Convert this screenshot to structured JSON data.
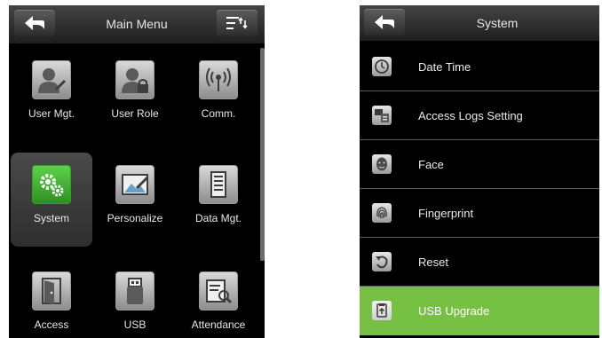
{
  "main_menu": {
    "title": "Main Menu",
    "items": [
      {
        "label": "User Mgt.",
        "icon": "user-edit-icon"
      },
      {
        "label": "User Role",
        "icon": "user-lock-icon"
      },
      {
        "label": "Comm.",
        "icon": "wireless-signal-icon"
      },
      {
        "label": "System",
        "icon": "gears-icon",
        "selected": true
      },
      {
        "label": "Personalize",
        "icon": "picture-pen-icon"
      },
      {
        "label": "Data Mgt.",
        "icon": "computer-tower-icon"
      },
      {
        "label": "Access",
        "icon": "door-icon"
      },
      {
        "label": "USB",
        "icon": "usb-drive-icon"
      },
      {
        "label": "Attendance",
        "icon": "report-search-icon"
      }
    ],
    "selected_color": "#3a9c2a"
  },
  "system_menu": {
    "title": "System",
    "items": [
      {
        "label": "Date Time",
        "icon": "clock-icon"
      },
      {
        "label": "Access Logs Setting",
        "icon": "logs-setting-icon"
      },
      {
        "label": "Face",
        "icon": "face-icon"
      },
      {
        "label": "Fingerprint",
        "icon": "fingerprint-icon"
      },
      {
        "label": "Reset",
        "icon": "reset-icon"
      },
      {
        "label": "USB Upgrade",
        "icon": "usb-upgrade-icon",
        "highlighted": true
      }
    ],
    "highlight_color": "#76c043"
  }
}
